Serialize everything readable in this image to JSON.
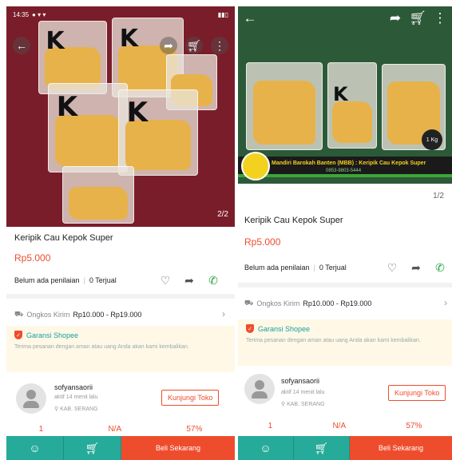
{
  "left": {
    "status_time": "14:35",
    "image_counter": "2/2",
    "product_title": "Keripik Cau Kepok Super",
    "price": "Rp5.000",
    "rating_text": "Belum ada penilaian",
    "sold_text": "0 Terjual",
    "shipping_label": "Ongkos Kirim",
    "shipping_value": "Rp10.000 - Rp19.000",
    "guarantee_title": "Garansi Shopee",
    "guarantee_body": "Terima pesanan dengan aman atau uang Anda akan kami kembalikan.",
    "seller_name": "sofyansaorii",
    "seller_active": "aktif 14 menit lalu",
    "seller_location": "KAB. SERANG",
    "visit_shop_label": "Kunjungi Toko",
    "stats": [
      "1",
      "N/A",
      "57%"
    ],
    "buy_label": "Beli Sekarang"
  },
  "right": {
    "image_counter": "1/2",
    "banner_text": "Mandiri Barokah Banten (MBB) : Keripik Cau Kepok Super",
    "banner_phone": "0853-9803-5444",
    "kg_badge": "1 Kg",
    "product_title": "Keripik Cau Kepok Super",
    "price": "Rp5.000",
    "rating_text": "Belum ada penilaian",
    "sold_text": "0 Terjual",
    "shipping_label": "Ongkos Kirim",
    "shipping_value": "Rp10.000 - Rp19.000",
    "guarantee_title": "Garansi Shopee",
    "guarantee_body": "Terima pesanan dengan aman atau uang Anda akan kami kembalikan.",
    "seller_name": "sofyansaorii",
    "seller_active": "aktif 14 menit lalu",
    "seller_location": "KAB. SERANG",
    "visit_shop_label": "Kunjungi Toko",
    "stats": [
      "1",
      "N/A",
      "57%"
    ],
    "buy_label": "Beli Sekarang"
  },
  "icons": {
    "back": "back-arrow-icon",
    "share": "share-icon",
    "cart": "cart-icon",
    "more": "more-icon",
    "heart": "heart-icon",
    "whatsapp": "whatsapp-icon",
    "truck": "truck-icon",
    "chat": "chat-icon"
  },
  "colors": {
    "accent": "#ee4d2d",
    "teal": "#26aa99",
    "guarantee_bg": "#fff8e6"
  }
}
